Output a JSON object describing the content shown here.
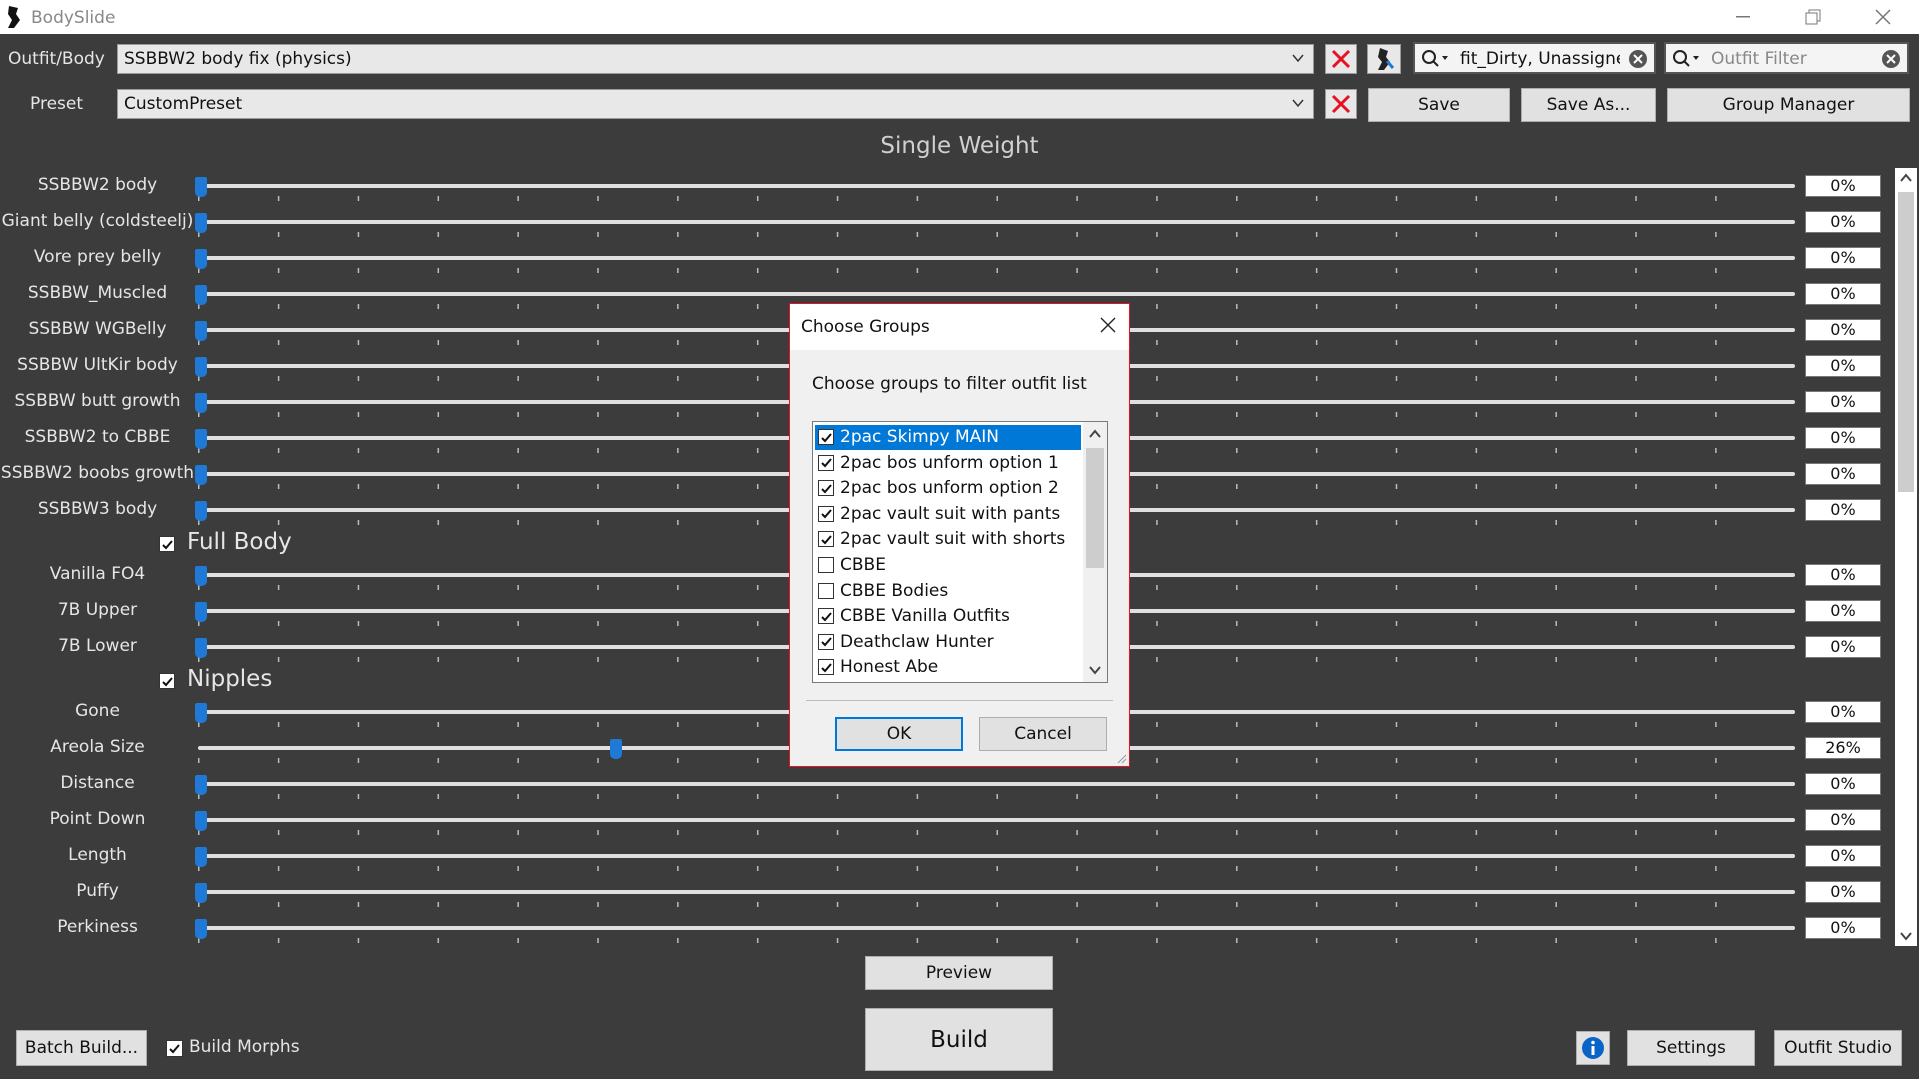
{
  "window": {
    "title": "BodySlide",
    "minimize_icon": "minimize-icon",
    "restore_icon": "restore-icon",
    "close_icon": "close-icon"
  },
  "header": {
    "outfit_label": "Outfit/Body",
    "outfit_value": "SSBBW2 body fix (physics)",
    "preset_label": "Preset",
    "preset_value": "CustomPreset",
    "group_filter_value": "fit_Dirty, Unassigned",
    "outfit_filter_placeholder": "Outfit Filter",
    "save_label": "Save",
    "save_as_label": "Save As...",
    "group_manager_label": "Group Manager"
  },
  "weight_title": "Single Weight",
  "sliders_top": [
    {
      "label": "SSBBW2 body",
      "value": "0%",
      "pct": 0
    },
    {
      "label": "Giant belly (coldsteelj)",
      "value": "0%",
      "pct": 0
    },
    {
      "label": "Vore prey belly",
      "value": "0%",
      "pct": 0
    },
    {
      "label": "SSBBW_Muscled",
      "value": "0%",
      "pct": 0
    },
    {
      "label": "SSBBW WGBelly",
      "value": "0%",
      "pct": 0
    },
    {
      "label": "SSBBW UltKir body",
      "value": "0%",
      "pct": 0
    },
    {
      "label": "SSBBW butt growth",
      "value": "0%",
      "pct": 0
    },
    {
      "label": "SSBBW2 to CBBE",
      "value": "0%",
      "pct": 0
    },
    {
      "label": "SSBBW2 boobs growth",
      "value": "0%",
      "pct": 0
    },
    {
      "label": "SSBBW3 body",
      "value": "0%",
      "pct": 0
    }
  ],
  "category_full_body": {
    "title": "Full Body",
    "checked": true,
    "sliders": [
      {
        "label": "Vanilla FO4",
        "value": "0%",
        "pct": 0
      },
      {
        "label": "7B Upper",
        "value": "0%",
        "pct": 0
      },
      {
        "label": "7B Lower",
        "value": "0%",
        "pct": 0
      }
    ]
  },
  "category_nipples": {
    "title": "Nipples",
    "checked": true,
    "sliders": [
      {
        "label": "Gone",
        "value": "0%",
        "pct": 0
      },
      {
        "label": "Areola Size",
        "value": "26%",
        "pct": 26
      },
      {
        "label": "Distance",
        "value": "0%",
        "pct": 0
      },
      {
        "label": "Point Down",
        "value": "0%",
        "pct": 0
      },
      {
        "label": "Length",
        "value": "0%",
        "pct": 0
      },
      {
        "label": "Puffy",
        "value": "0%",
        "pct": 0
      },
      {
        "label": "Perkiness",
        "value": "0%",
        "pct": 0
      }
    ]
  },
  "dialog": {
    "title": "Choose Groups",
    "prompt": "Choose groups to filter outfit list",
    "items": [
      {
        "label": "2pac Skimpy MAIN",
        "checked": true,
        "selected": true
      },
      {
        "label": "2pac bos unform option 1",
        "checked": true,
        "selected": false
      },
      {
        "label": "2pac bos unform option 2",
        "checked": true,
        "selected": false
      },
      {
        "label": "2pac vault suit with pants",
        "checked": true,
        "selected": false
      },
      {
        "label": "2pac vault suit with shorts",
        "checked": true,
        "selected": false
      },
      {
        "label": "CBBE",
        "checked": false,
        "selected": false
      },
      {
        "label": "CBBE Bodies",
        "checked": false,
        "selected": false
      },
      {
        "label": "CBBE Vanilla Outfits",
        "checked": true,
        "selected": false
      },
      {
        "label": "Deathclaw Hunter",
        "checked": true,
        "selected": false
      },
      {
        "label": "Honest Abe",
        "checked": true,
        "selected": false
      }
    ],
    "ok_label": "OK",
    "cancel_label": "Cancel"
  },
  "bottom": {
    "preview_label": "Preview",
    "build_label": "Build",
    "batch_build_label": "Batch Build...",
    "build_morphs_label": "Build Morphs",
    "build_morphs_checked": true,
    "settings_label": "Settings",
    "outfit_studio_label": "Outfit Studio"
  },
  "colors": {
    "background": "#3c3c3c",
    "accent": "#1e7ad6",
    "delete_x": "#e81123"
  }
}
